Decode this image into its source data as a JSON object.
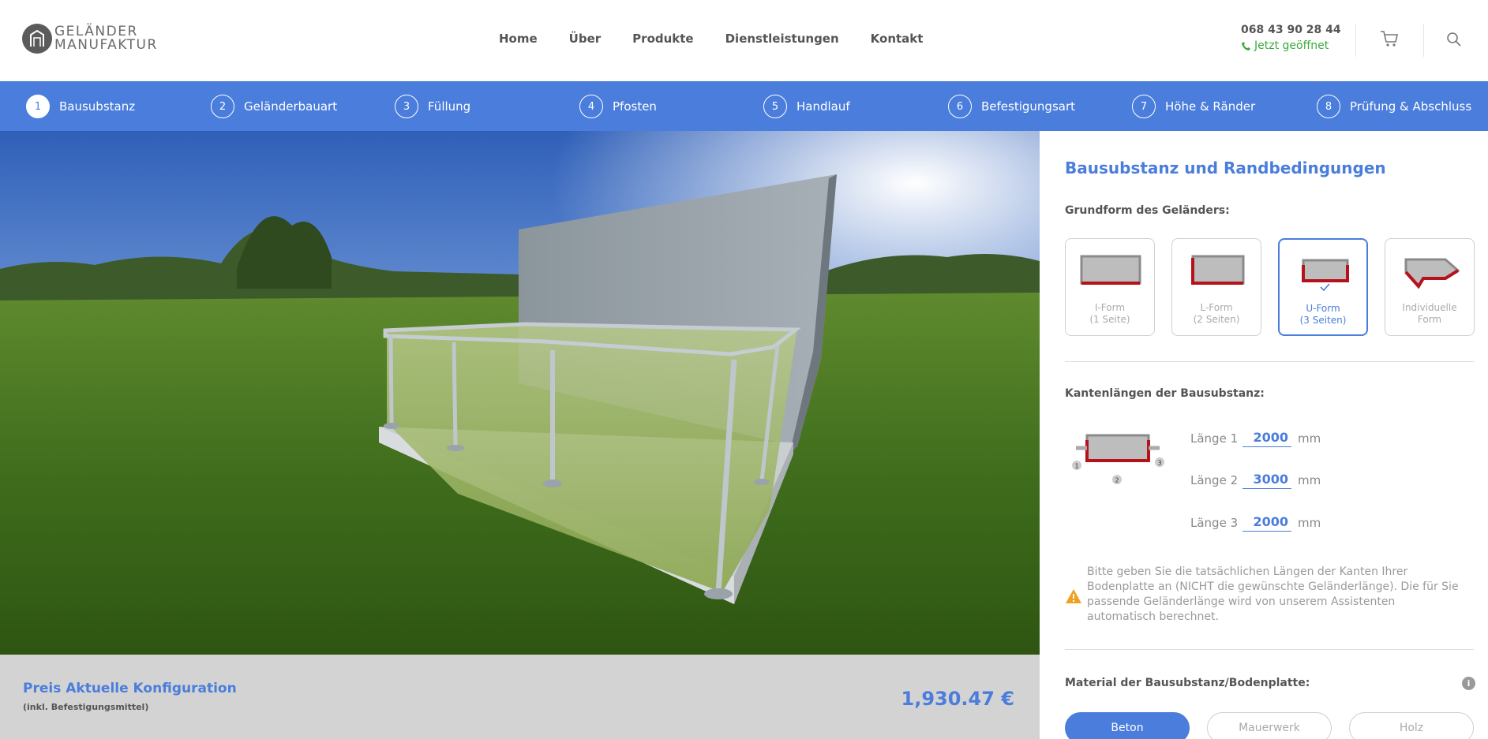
{
  "header": {
    "logo_line1": "GELÄNDER",
    "logo_line2": "MANUFAKTUR",
    "nav": [
      "Home",
      "Über",
      "Produkte",
      "Dienstleistungen",
      "Kontakt"
    ],
    "phone": "068 43 90 28 44",
    "open_status": "Jetzt geöffnet"
  },
  "steps": [
    {
      "num": "1",
      "label": "Bausubstanz",
      "active": true
    },
    {
      "num": "2",
      "label": "Geländerbauart"
    },
    {
      "num": "3",
      "label": "Füllung"
    },
    {
      "num": "4",
      "label": "Pfosten"
    },
    {
      "num": "5",
      "label": "Handlauf"
    },
    {
      "num": "6",
      "label": "Befestigungsart"
    },
    {
      "num": "7",
      "label": "Höhe & Ränder"
    },
    {
      "num": "8",
      "label": "Prüfung & Abschluss"
    }
  ],
  "price": {
    "title": "Preis Aktuelle Konfiguration",
    "subtitle": "(inkl. Befestigungsmittel)",
    "value": "1,930.47 €"
  },
  "panel": {
    "title": "Bausubstanz und Randbedingungen",
    "shape_label": "Grundform des Geländers:",
    "shapes": [
      {
        "line1": "I-Form",
        "line2": "(1 Seite)"
      },
      {
        "line1": "L-Form",
        "line2": "(2 Seiten)"
      },
      {
        "line1": "U-Form",
        "line2": "(3 Seiten)",
        "selected": true
      },
      {
        "line1": "Individuelle",
        "line2": "Form"
      }
    ],
    "edges_label": "Kantenlängen der Bausubstanz:",
    "lengths": [
      {
        "label": "Länge 1",
        "value": "2000",
        "unit": "mm"
      },
      {
        "label": "Länge 2",
        "value": "3000",
        "unit": "mm"
      },
      {
        "label": "Länge 3",
        "value": "2000",
        "unit": "mm"
      }
    ],
    "diagram_numbers": [
      "1",
      "2",
      "3"
    ],
    "note": "Bitte geben Sie die tatsächlichen Längen der Kanten Ihrer Bodenplatte an (NICHT die gewünschte Geländerlänge). Die für Sie passende Geländerlänge wird von unserem Assistenten automatisch berechnet.",
    "material_label": "Material der Bausubstanz/Bodenplatte:",
    "info": "i",
    "materials": [
      {
        "label": "Beton",
        "active": true
      },
      {
        "label": "Mauerwerk"
      },
      {
        "label": "Holz"
      }
    ]
  },
  "colors": {
    "accent": "#4a7ddc",
    "open_green": "#3aaa3a",
    "edge_red": "#b5121b",
    "warning": "#f0a020"
  }
}
